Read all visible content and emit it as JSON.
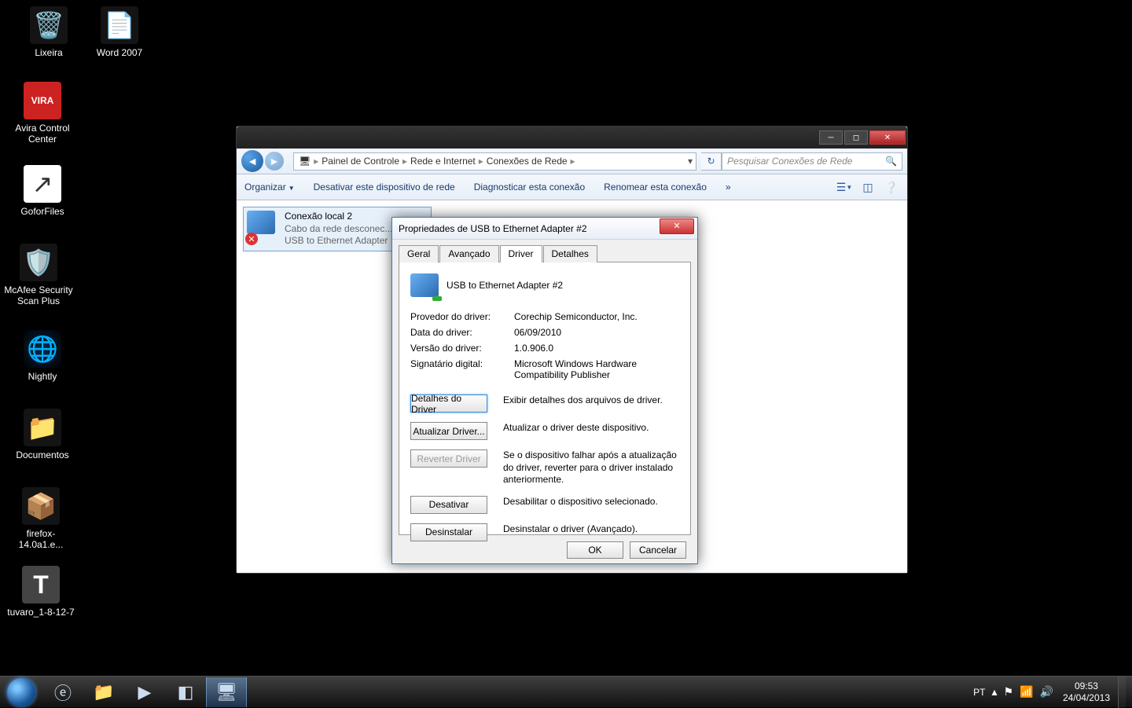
{
  "desktop": {
    "icons": [
      {
        "label": "Lixeira"
      },
      {
        "label": "Word 2007"
      },
      {
        "label": "Avira Control Center"
      },
      {
        "label": "GoforFiles"
      },
      {
        "label": "McAfee Security Scan Plus"
      },
      {
        "label": "Nightly"
      },
      {
        "label": "Documentos"
      },
      {
        "label": "firefox-14.0a1.e..."
      },
      {
        "label": "tuvaro_1-8-12-7"
      }
    ]
  },
  "explorer": {
    "breadcrumbs": [
      "Painel de Controle",
      "Rede e Internet",
      "Conexões de Rede"
    ],
    "search_placeholder": "Pesquisar Conexões de Rede",
    "toolbar": {
      "organize": "Organizar",
      "disable": "Desativar este dispositivo de rede",
      "diagnose": "Diagnosticar esta conexão",
      "rename": "Renomear esta conexão",
      "more": "»"
    },
    "connection": {
      "name": "Conexão local 2",
      "status": "Cabo da rede desconec...",
      "device": "USB to Ethernet Adapter"
    }
  },
  "dialog": {
    "title": "Propriedades de USB to Ethernet Adapter #2",
    "tabs": {
      "geral": "Geral",
      "avancado": "Avançado",
      "driver": "Driver",
      "detalhes": "Detalhes"
    },
    "device_name": "USB to Ethernet Adapter #2",
    "rows": {
      "provider_k": "Provedor do driver:",
      "provider_v": "Corechip Semiconductor, Inc.",
      "date_k": "Data do driver:",
      "date_v": "06/09/2010",
      "version_k": "Versão do driver:",
      "version_v": "1.0.906.0",
      "signer_k": "Signatário digital:",
      "signer_v": "Microsoft Windows Hardware Compatibility Publisher"
    },
    "buttons": {
      "details": "Detalhes do Driver",
      "details_desc": "Exibir detalhes dos arquivos de driver.",
      "update": "Atualizar Driver...",
      "update_desc": "Atualizar o driver deste dispositivo.",
      "rollback": "Reverter Driver",
      "rollback_desc": "Se o dispositivo falhar após a atualização do driver, reverter para o driver instalado anteriormente.",
      "disable": "Desativar",
      "disable_desc": "Desabilitar o dispositivo selecionado.",
      "uninstall": "Desinstalar",
      "uninstall_desc": "Desinstalar o driver (Avançado).",
      "ok": "OK",
      "cancel": "Cancelar"
    }
  },
  "taskbar": {
    "lang": "PT",
    "time": "09:53",
    "date": "24/04/2013"
  }
}
